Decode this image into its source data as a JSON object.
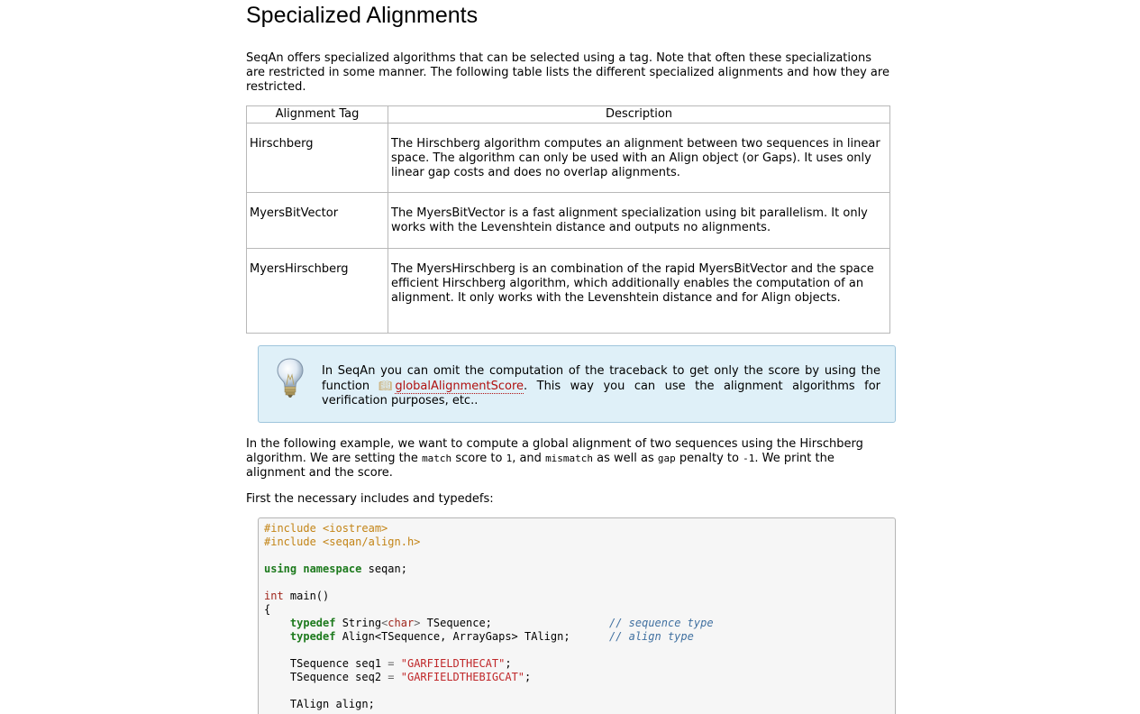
{
  "page": {
    "title": "Specialized Alignments",
    "intro": "SeqAn offers specialized algorithms that can be selected using a tag. Note that often these specializations are restricted in some manner. The following table lists the different specialized alignments and how they are restricted."
  },
  "table": {
    "headers": [
      "Alignment Tag",
      "Description"
    ],
    "rows": [
      {
        "tag": "Hirschberg",
        "description": "The Hirschberg algorithm computes an alignment between two sequences in linear space. The algorithm can only be used with an Align object (or Gaps). It uses only linear gap costs and does no overlap alignments."
      },
      {
        "tag": "MyersBitVector",
        "description": "The MyersBitVector is a fast alignment specialization using bit parallelism. It only works with the Levenshtein distance and outputs no alignments."
      },
      {
        "tag": "MyersHirschberg",
        "description": "The MyersHirschberg is an combination of the rapid MyersBitVector and the space efficient Hirschberg algorithm, which additionally enables the computation of an alignment. It only works with the Levenshtein distance and for Align objects."
      }
    ]
  },
  "tip": {
    "icon": "lightbulb-icon",
    "text_before": "In SeqAn you can omit the computation of the traceback to get only the score by using the function",
    "link_icon": "book-icon",
    "link_text": "globalAlignmentScore",
    "text_after": ". This way you can use the alignment algorithms for verification purposes, etc..",
    "colors": {
      "background": "#dff0f8",
      "border": "#9ec5dc",
      "link": "#b01010"
    }
  },
  "example": {
    "p1": "In the following example, we want to compute a global alignment of two sequences using the Hirschberg algorithm. We are setting the ",
    "c1": "match",
    "p2": " score to ",
    "c2": "1",
    "p3": ", and ",
    "c3": "mismatch",
    "p4": " as well as ",
    "c4": "gap",
    "p5": " penalty to ",
    "c5": "-1",
    "p6": ". We print the alignment and the score."
  },
  "first_text": "First the necessary includes and typedefs:",
  "code": {
    "include1": "#include <iostream>",
    "include2": "#include <seqan/align.h>",
    "using_kw": "using namespace",
    "using_rest": " seqan;",
    "int_kw": "int",
    "main_rest": " main()",
    "brace": "{",
    "typedef_kw": "typedef",
    "td1_a": " String",
    "td1_lt": "<",
    "td1_char": "char",
    "td1_gt": ">",
    "td1_b": " TSequence;",
    "td1_comment": "// sequence type",
    "td2_a": " Align<TSequence, ArrayGaps> TAlign;",
    "td2_comment": "// align type",
    "s1_a": "TSequence seq1 ",
    "s1_str": "\"GARFIELDTHECAT\"",
    "s2_a": "TSequence seq2 ",
    "s2_str": "\"GARFIELDTHEBIGCAT\"",
    "eq": "=",
    "semi": ";",
    "talign": "TAlign align;"
  }
}
